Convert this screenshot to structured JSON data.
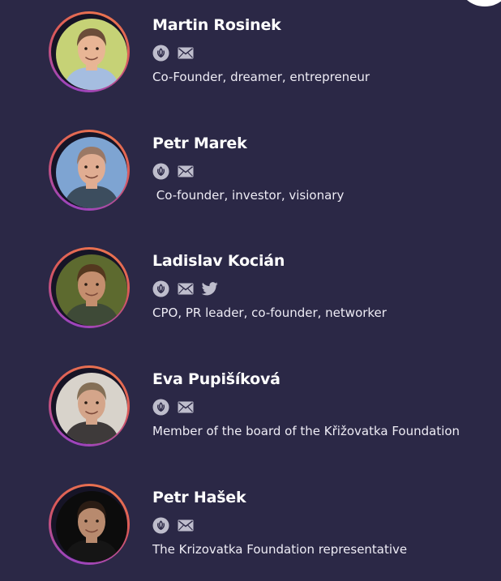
{
  "members": [
    {
      "name": "Martin Rosinek",
      "role": "Co-Founder, dreamer, entrepreneur",
      "icons": [
        "linkedin-icon",
        "email-icon"
      ],
      "photo": {
        "bg": "#c6d276",
        "skin": "#e8b595",
        "hair": "#6b4d39",
        "shirt": "#a5bde0"
      }
    },
    {
      "name": "Petr Marek",
      "role": " Co-founder, investor, visionary",
      "icons": [
        "linkedin-icon",
        "email-icon"
      ],
      "photo": {
        "bg": "#7ea4d2",
        "skin": "#e0ad92",
        "hair": "#9a7865",
        "shirt": "#3c4d5e"
      }
    },
    {
      "name": "Ladislav Kocián",
      "role": "CPO, PR leader, co-founder, networker",
      "icons": [
        "linkedin-icon",
        "email-icon",
        "twitter-icon"
      ],
      "photo": {
        "bg": "#5d6a2f",
        "skin": "#c48e6e",
        "hair": "#54381f",
        "shirt": "#3e4a37"
      }
    },
    {
      "name": "Eva Pupišíková",
      "role": "Member of the board of the Křižovatka Foundation",
      "icons": [
        "linkedin-icon",
        "email-icon"
      ],
      "photo": {
        "bg": "#d8d3cb",
        "skin": "#d4a58a",
        "hair": "#846f56",
        "shirt": "#3e3a3a"
      }
    },
    {
      "name": "Petr Hašek",
      "role": "The Krizovatka Foundation representative",
      "icons": [
        "linkedin-icon",
        "email-icon"
      ],
      "photo": {
        "bg": "#0c0c0c",
        "skin": "#b88a6e",
        "hair": "#2a1c14",
        "shirt": "#151515"
      }
    }
  ],
  "colors": {
    "background": "#2b2846",
    "text": "#ffffff",
    "icon": "#bebdcc",
    "ring_start": "#ef7a4c",
    "ring_end": "#8d3fd6"
  }
}
